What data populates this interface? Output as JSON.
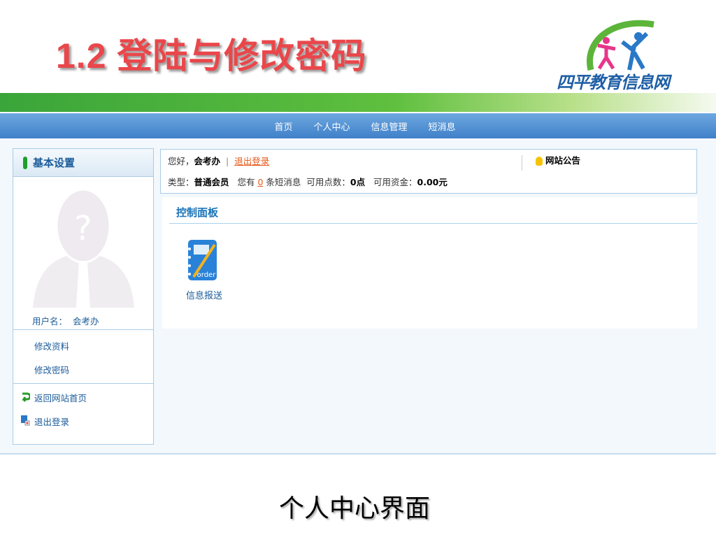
{
  "slide": {
    "title": "1.2 登陆与修改密码",
    "caption": "个人中心界面"
  },
  "logo": {
    "text": "四平教育信息网"
  },
  "nav": {
    "items": [
      "首页",
      "个人中心",
      "信息管理",
      "短消息"
    ]
  },
  "sidebar": {
    "header": "基本设置",
    "username_label": "用户名：",
    "username": "会考办",
    "links": [
      "修改资料",
      "修改密码"
    ],
    "back_home": "返回网站首页",
    "logout": "退出登录"
  },
  "info": {
    "greeting": "您好，",
    "user": "会考办",
    "divider": "|",
    "logout": "退出登录",
    "type_label": "类型：",
    "type": "普通会员",
    "msg_prefix": "您有",
    "msg_count": "0",
    "msg_suffix": "条短消息",
    "points_label": "可用点数：",
    "points": "0点",
    "funds_label": "可用资金：",
    "funds": "0.00元",
    "notice": "网站公告"
  },
  "control_panel": {
    "title": "控制面板",
    "items": [
      {
        "label": "信息报送",
        "icon_text": "order"
      }
    ]
  },
  "colors": {
    "title": "#e9474b",
    "nav": "#3f80c8",
    "link": "#1b5b9a",
    "accent": "#e8591a"
  }
}
